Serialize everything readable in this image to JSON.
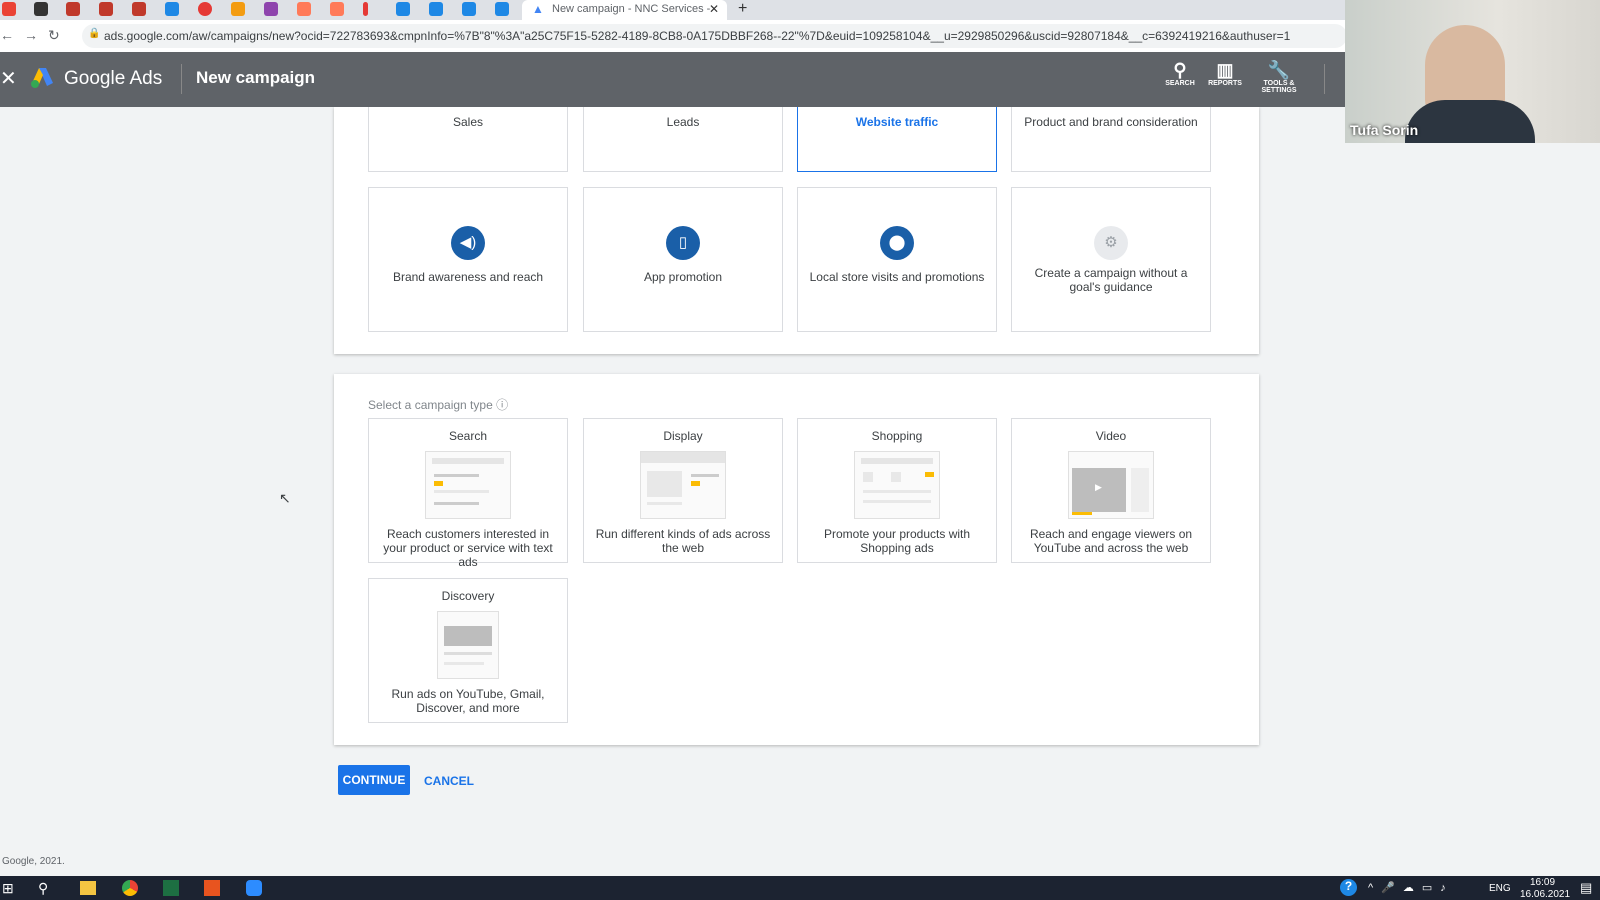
{
  "browser": {
    "tab_title": "New campaign - NNC Services -",
    "url": "ads.google.com/aw/campaigns/new?ocid=722783693&cmpnInfo=%7B\"8\"%3A\"a25C75F15-5282-4189-8CB8-0A175DBBF268--22\"%7D&euid=109258104&__u=2929850296&uscid=92807184&__c=6392419216&authuser=1"
  },
  "header": {
    "brand": "Google Ads",
    "title": "New campaign",
    "icons": [
      {
        "label": "SEARCH",
        "icon": "search-icon"
      },
      {
        "label": "REPORTS",
        "icon": "reports-icon"
      },
      {
        "label": "TOOLS & SETTINGS",
        "icon": "wrench-icon"
      }
    ]
  },
  "goals": [
    {
      "label": "Sales",
      "selected": false
    },
    {
      "label": "Leads",
      "selected": false
    },
    {
      "label": "Website traffic",
      "selected": true
    },
    {
      "label": "Product and brand consideration",
      "selected": false
    },
    {
      "label": "Brand awareness and reach",
      "icon": "megaphone-icon"
    },
    {
      "label": "App promotion",
      "icon": "phone-icon"
    },
    {
      "label": "Local store visits and promotions",
      "icon": "location-pin-icon"
    },
    {
      "label": "Create a campaign without a goal's guidance",
      "icon": "gear-icon"
    }
  ],
  "campaign_type": {
    "heading": "Select a campaign type",
    "types": [
      {
        "title": "Search",
        "desc": "Reach customers interested in your product or service with text ads"
      },
      {
        "title": "Display",
        "desc": "Run different kinds of ads across the web"
      },
      {
        "title": "Shopping",
        "desc": "Promote your products with Shopping ads"
      },
      {
        "title": "Video",
        "desc": "Reach and engage viewers on YouTube and across the web"
      },
      {
        "title": "Discovery",
        "desc": "Run ads on YouTube, Gmail, Discover, and more"
      }
    ]
  },
  "actions": {
    "continue": "CONTINUE",
    "cancel": "CANCEL"
  },
  "footer": "Google, 2021.",
  "webcam": {
    "name": "Tufa Sorin"
  },
  "taskbar": {
    "lang": "ENG",
    "time": "16:09",
    "date": "16.06.2021"
  },
  "colors": {
    "accent": "#1a73e8",
    "header": "#5f6368"
  }
}
